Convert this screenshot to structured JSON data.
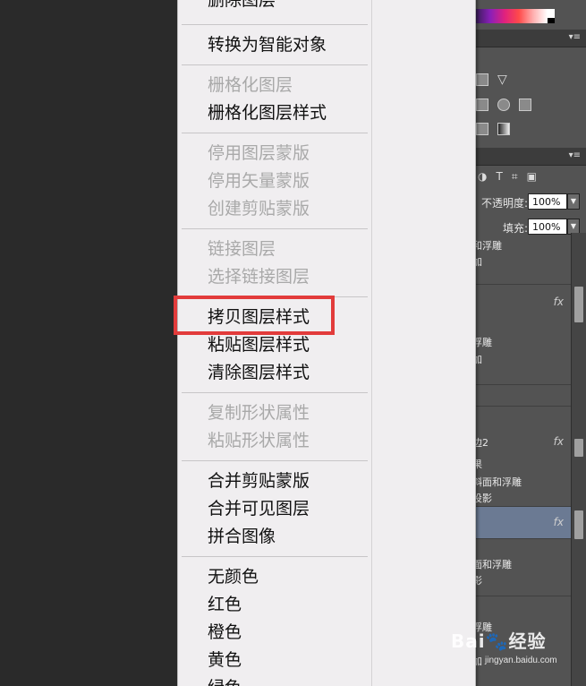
{
  "context_menu": {
    "items": [
      {
        "label": "删除图层",
        "enabled": true
      },
      {
        "label": "转换为智能对象",
        "enabled": true
      },
      {
        "label": "栅格化图层",
        "enabled": false
      },
      {
        "label": "栅格化图层样式",
        "enabled": true
      },
      {
        "label": "停用图层蒙版",
        "enabled": false
      },
      {
        "label": "停用矢量蒙版",
        "enabled": false
      },
      {
        "label": "创建剪贴蒙版",
        "enabled": false
      },
      {
        "label": "链接图层",
        "enabled": false
      },
      {
        "label": "选择链接图层",
        "enabled": false
      },
      {
        "label": "拷贝图层样式",
        "enabled": true,
        "highlighted": true
      },
      {
        "label": "粘贴图层样式",
        "enabled": true
      },
      {
        "label": "清除图层样式",
        "enabled": true
      },
      {
        "label": "复制形状属性",
        "enabled": false
      },
      {
        "label": "粘贴形状属性",
        "enabled": false
      },
      {
        "label": "合并剪贴蒙版",
        "enabled": true
      },
      {
        "label": "合并可见图层",
        "enabled": true
      },
      {
        "label": "拼合图像",
        "enabled": true
      },
      {
        "label": "无颜色",
        "enabled": true
      },
      {
        "label": "红色",
        "enabled": true
      },
      {
        "label": "橙色",
        "enabled": true
      },
      {
        "label": "黄色",
        "enabled": true
      },
      {
        "label": "绿色",
        "enabled": true
      }
    ],
    "highlight_color": "#e23b3b"
  },
  "layers_panel": {
    "toolbar_icons": [
      "circle-filter-icon",
      "type-filter-icon",
      "transform-filter-icon",
      "smart-object-filter-icon"
    ],
    "toolbar_glyphs": [
      "◑",
      "T",
      "⌗",
      "▣"
    ],
    "opacity_label": "不透明度:",
    "opacity_value": "100%",
    "fill_label": "填充:",
    "fill_value": "100%",
    "effect_rows": {
      "r1a": "和浮雕",
      "r1b": "加",
      "r2a": "浮雕",
      "r2b": "加",
      "r3a": "边2",
      "r3b": "果",
      "r3c": "斜面和浮雕",
      "r3d": "投影",
      "r4a": "面和浮雕",
      "r4b": "影",
      "r5a": "浮雕",
      "r5b": "加"
    },
    "fx_label": "fx"
  },
  "adjustments_glyphs": [
    "▽",
    "◆",
    "▦",
    "◩",
    "◫"
  ],
  "panel_menu_glyph": "▾≡",
  "watermark": {
    "brand": "Bai🐾经验",
    "url": "jingyan.baidu.com"
  }
}
